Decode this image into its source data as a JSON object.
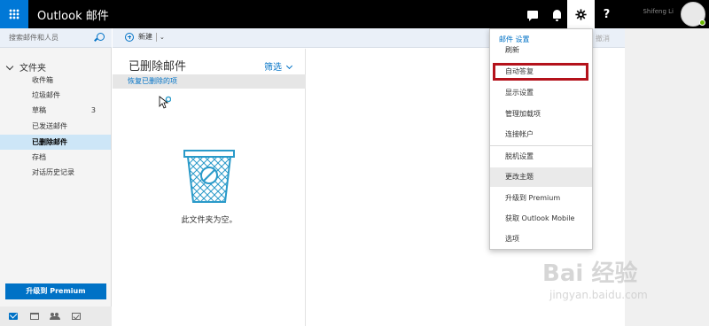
{
  "topbar": {
    "app_title": "Outlook 邮件",
    "icons": [
      "waffle-icon",
      "chat-icon",
      "bell-icon",
      "gear-icon",
      "help-icon"
    ],
    "help_label": "?",
    "user_name": "Shifeng Li"
  },
  "leftnav": {
    "search_placeholder": "搜索邮件和人员",
    "folders_header": "文件夹",
    "folders": [
      {
        "label": "收件箱",
        "count": ""
      },
      {
        "label": "垃圾邮件",
        "count": ""
      },
      {
        "label": "草稿",
        "count": "3"
      },
      {
        "label": "已发送邮件",
        "count": ""
      },
      {
        "label": "已删除邮件",
        "count": "",
        "selected": true
      },
      {
        "label": "存档",
        "count": ""
      },
      {
        "label": "对话历史记录",
        "count": ""
      }
    ],
    "upgrade_label": "升级到 Premium",
    "bottom_icons": [
      "mail-icon",
      "calendar-icon",
      "people-icon",
      "tasks-icon"
    ]
  },
  "toolbar": {
    "new_label": "新建",
    "undo_label": "撤消"
  },
  "message_list": {
    "title": "已删除邮件",
    "filter_label": "筛选",
    "recover_label": "恢复已删除的项",
    "empty_text": "此文件夹为空。"
  },
  "settings_menu": {
    "header": "邮件 设置",
    "items": [
      {
        "label": "刷新"
      },
      {
        "label": "自动答复",
        "highlighted": true
      },
      {
        "label": "显示设置"
      },
      {
        "label": "管理加载项"
      },
      {
        "label": "连接帐户"
      },
      {
        "label": "脱机设置"
      },
      {
        "label": "更改主题",
        "hover": true
      },
      {
        "label": "升级到 Premium"
      },
      {
        "label": "获取 Outlook Mobile"
      },
      {
        "label": "选项"
      }
    ]
  },
  "watermark": {
    "logo": "Bai 经验",
    "url": "jingyan.baidu.com"
  },
  "colors": {
    "brand_blue": "#0072c6",
    "highlight_red": "#b4121b",
    "topbar": "#000000",
    "selected_folder": "#cde6f7"
  }
}
